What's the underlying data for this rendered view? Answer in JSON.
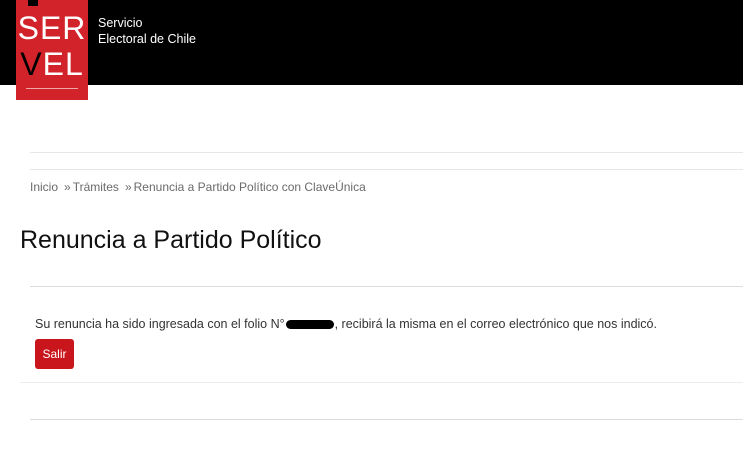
{
  "header": {
    "logo_line1": "SER",
    "logo_v": "V",
    "logo_el": "EL",
    "brand_line1": "Servicio",
    "brand_line2": "Electoral de Chile"
  },
  "breadcrumb": {
    "items": [
      "Inicio",
      "Trámites",
      "Renuncia a Partido Político con ClaveÚnica"
    ],
    "separator": "»"
  },
  "page_title": "Renuncia a Partido Político",
  "message": {
    "before": "Su renuncia ha sido ingresada con el folio N°",
    "after": ", recibirá la misma en el correo electrónico que nos indicó."
  },
  "exit_button_label": "Salir",
  "colors": {
    "brand_red": "#d2232a",
    "button_red": "#c9161d",
    "header_bg": "#000000"
  }
}
